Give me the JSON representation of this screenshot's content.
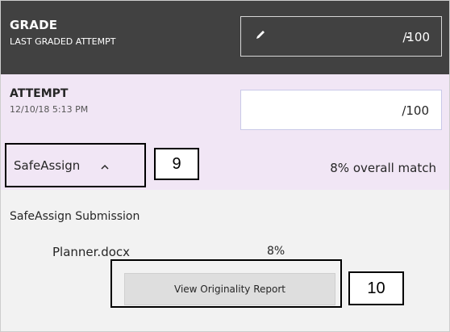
{
  "grade": {
    "title": "GRADE",
    "subtitle": "LAST GRADED ATTEMPT",
    "value": "-",
    "denominator": "/100",
    "edit_icon": "pencil-icon"
  },
  "attempt": {
    "title": "ATTEMPT",
    "date": "12/10/18 5:13 PM",
    "denominator": "/100"
  },
  "safeassign": {
    "toggle_label": "SafeAssign",
    "toggle_icon": "chevron-up-icon",
    "overall_match": "8% overall match",
    "submission_heading": "SafeAssign Submission",
    "file_name": "Planner.docx",
    "file_match": "8%",
    "report_button": "View Originality Report"
  },
  "callouts": {
    "toggle": "9",
    "report": "10"
  },
  "colors": {
    "header_bg": "#414141",
    "attempt_bg": "#f1e6f5",
    "section_bg": "#f2f2f2",
    "button_bg": "#dedede"
  }
}
